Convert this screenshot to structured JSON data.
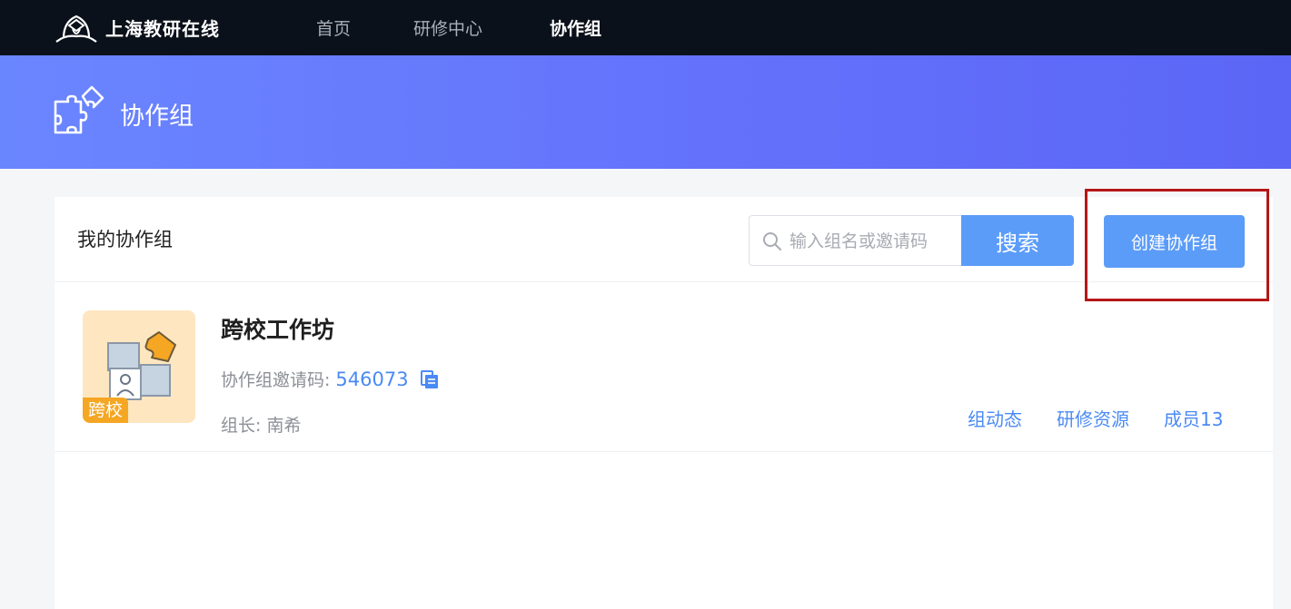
{
  "header": {
    "brand_name": "上海教研在线",
    "nav": [
      {
        "label": "首页",
        "active": false
      },
      {
        "label": "研修中心",
        "active": false
      },
      {
        "label": "协作组",
        "active": true
      }
    ]
  },
  "banner": {
    "title": "协作组"
  },
  "panel": {
    "title": "我的协作组",
    "search_placeholder": "输入组名或邀请码",
    "search_value": "",
    "search_button": "搜索",
    "create_button": "创建协作组"
  },
  "groups": [
    {
      "name": "跨校工作坊",
      "tag": "跨校",
      "invite_label": "协作组邀请码:",
      "invite_code": "546073",
      "leader_label": "组长:",
      "leader_name": "南希",
      "links": [
        "组动态",
        "研修资源",
        "成员13"
      ]
    }
  ],
  "colors": {
    "nav_bg": "#0b111a",
    "banner_start": "#6a86ff",
    "banner_end": "#5b66f6",
    "primary": "#5b9cf8",
    "link": "#4a8af4",
    "tag": "#f5a623",
    "cover_bg": "#fde6c0",
    "highlight": "#b51717"
  },
  "icons": {
    "brand": "graduation-logo-icon",
    "banner": "puzzle-icon",
    "search": "search-icon",
    "copy": "copy-icon"
  }
}
